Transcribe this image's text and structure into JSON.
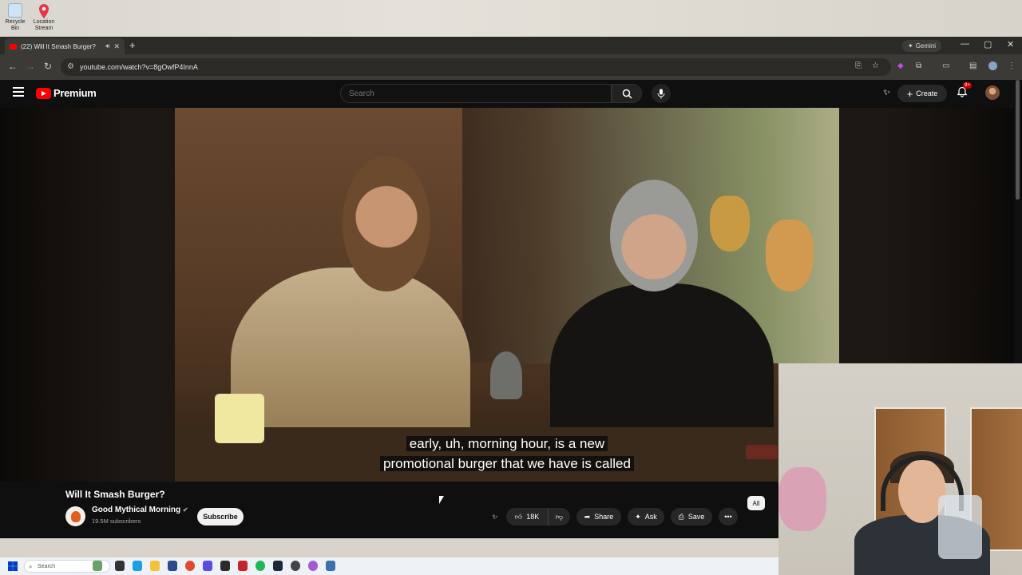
{
  "desktop": {
    "icons": [
      {
        "label": "Recycle Bin",
        "icon": "recycle-bin-icon"
      },
      {
        "label": "Location Stream",
        "icon": "map-pin-icon"
      }
    ]
  },
  "browser": {
    "tab": {
      "title": "(22) Will It Smash Burger?",
      "icon": "youtube-favicon"
    },
    "new_tab": "+",
    "gemini": "Gemini",
    "url": "youtube.com/watch?v=8gOwfP4InnA",
    "window_controls": [
      "—",
      "▢",
      "✕"
    ]
  },
  "youtube": {
    "logo_text": "Premium",
    "search_placeholder": "Search",
    "create_label": "Create",
    "notifications_badge": "9+",
    "video": {
      "caption_line1": "early, uh, morning hour, is a new",
      "caption_line2": "promotional burger that we have is called"
    },
    "meta": {
      "title": "Will It Smash Burger?",
      "channel_name": "Good Mythical Morning",
      "subscribers": "19.5M subscribers",
      "subscribe_label": "Subscribe",
      "likes": "18K",
      "share_label": "Share",
      "ask_label": "Ask",
      "save_label": "Save",
      "all_chip": "All"
    }
  },
  "taskbar": {
    "search_placeholder": "Search"
  },
  "colors": {
    "youtube_red": "#ff0000",
    "page_bg": "#0f0f0f",
    "chip_bg": "#272727"
  }
}
